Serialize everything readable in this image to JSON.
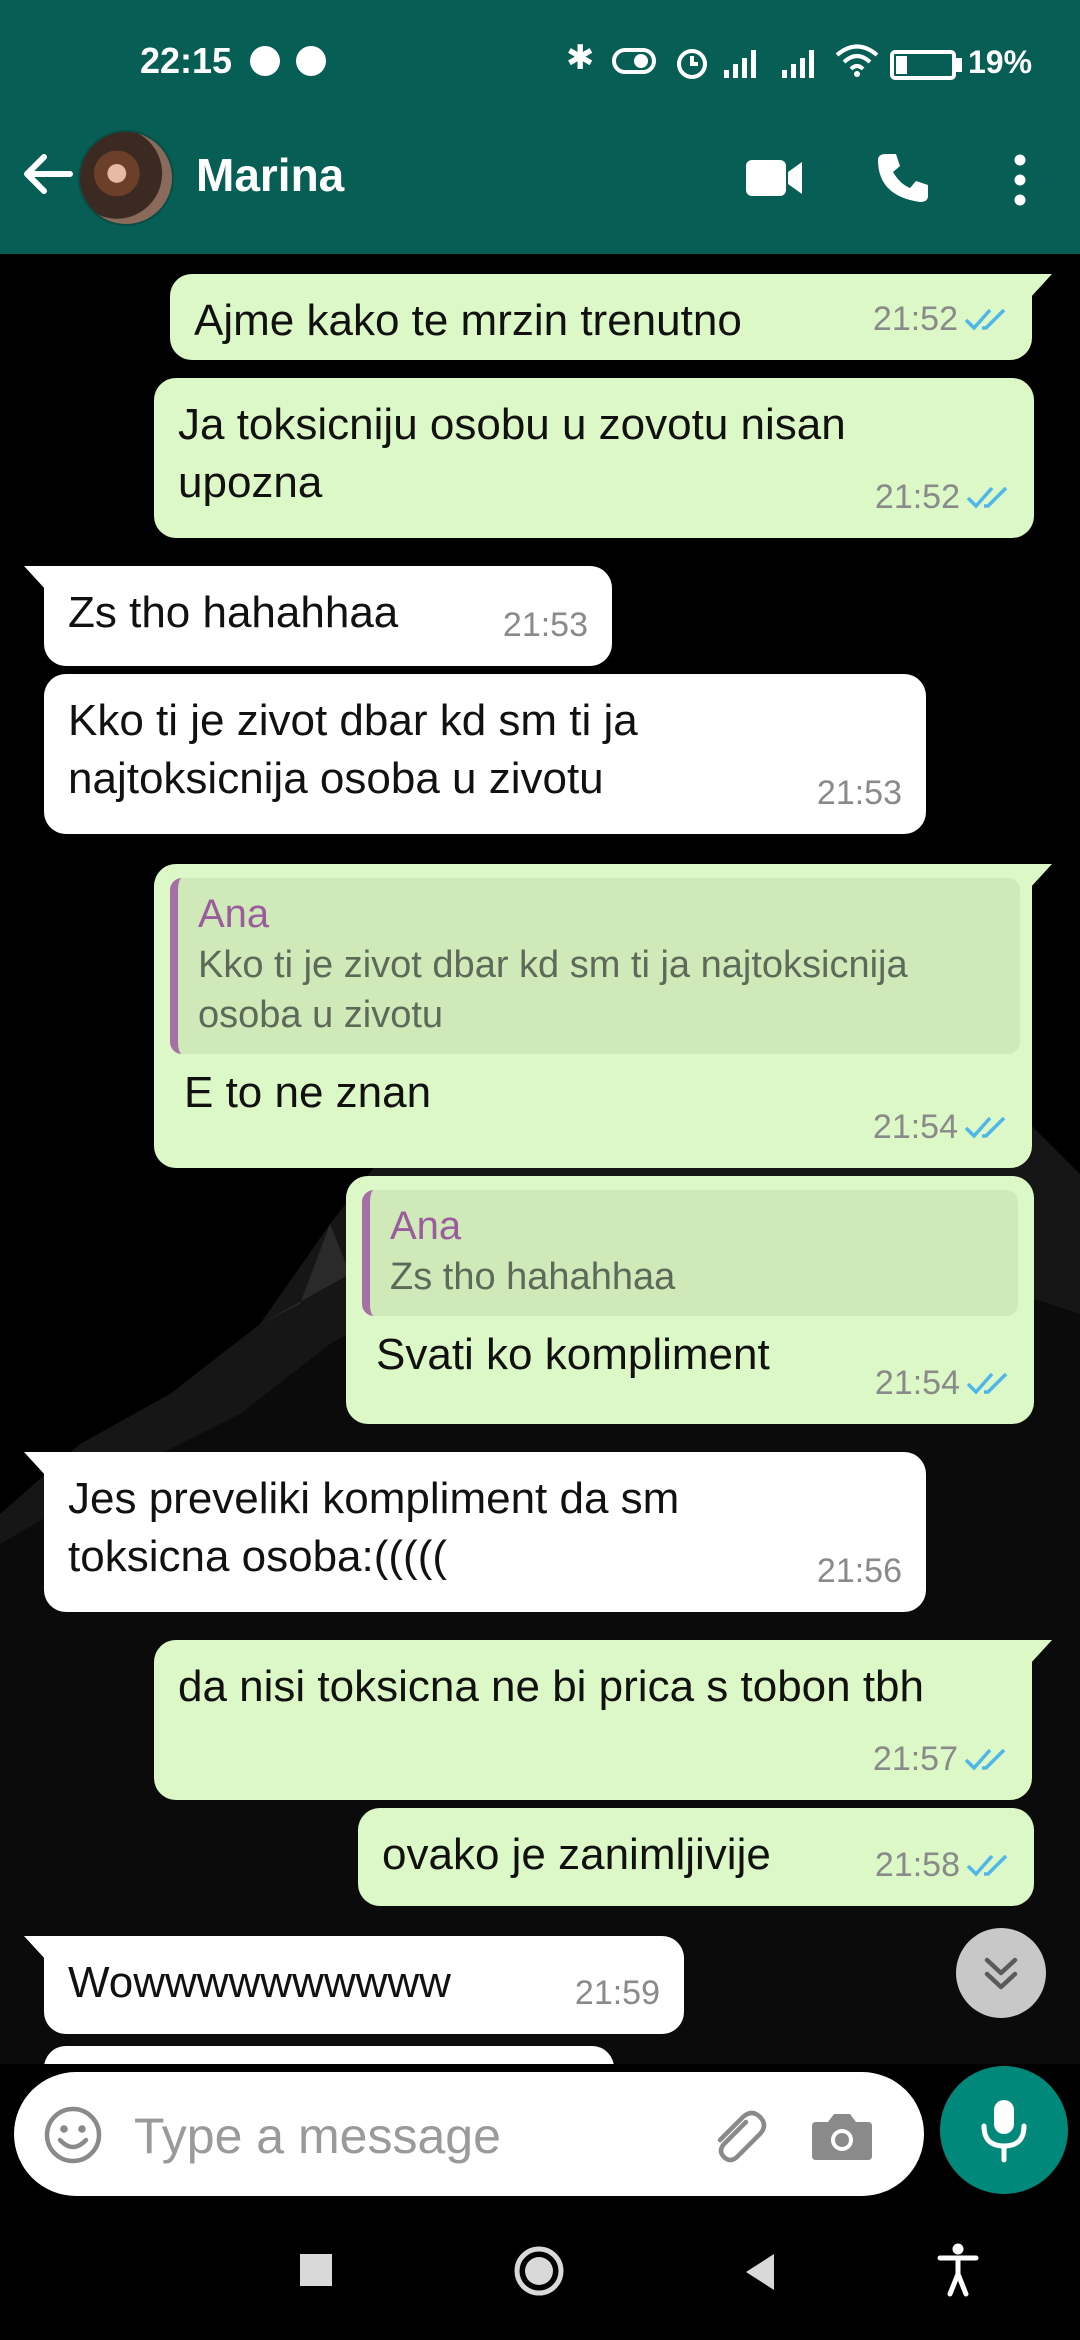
{
  "status_bar": {
    "time": "22:15",
    "battery_text": "19%",
    "battery_level": 0.19,
    "icons": [
      "spotify-icon",
      "messenger-icon",
      "bluetooth-icon",
      "toggle-icon",
      "alarm-icon",
      "signal-icon",
      "signal-icon",
      "wifi-icon",
      "battery-charging-icon"
    ]
  },
  "header": {
    "contact_name": "Marina",
    "icons": [
      "back-arrow-icon",
      "avatar",
      "video-call-icon",
      "phone-icon",
      "more-vert-icon"
    ]
  },
  "messages": [
    {
      "dir": "out",
      "text": "Ajme kako te mrzin trenutno",
      "time": "21:52",
      "ticks": "read"
    },
    {
      "dir": "out",
      "text": "Ja toksicniju osobu u zovotu nisan upozna",
      "time": "21:52",
      "ticks": "read"
    },
    {
      "dir": "in",
      "text": "Zs tho hahahhaa",
      "time": "21:53"
    },
    {
      "dir": "in",
      "text": "Kko ti je zivot dbar kd sm ti ja najtoksicnija osoba u zivotu",
      "time": "21:53"
    },
    {
      "dir": "out",
      "quote_author": "Ana",
      "quote_text": "Kko ti je zivot dbar kd sm ti ja najtoksicnija osoba u zivotu",
      "text": "E to ne znan",
      "time": "21:54",
      "ticks": "read"
    },
    {
      "dir": "out",
      "quote_author": "Ana",
      "quote_text": "Zs tho hahahhaa",
      "text": "Svati ko kompliment",
      "time": "21:54",
      "ticks": "read"
    },
    {
      "dir": "in",
      "text": "Jes preveliki kompliment da sm toksicna osoba:(((((",
      "time": "21:56"
    },
    {
      "dir": "out",
      "text": "da nisi toksicna ne bi prica s tobon tbh",
      "time": "21:57",
      "ticks": "read"
    },
    {
      "dir": "out",
      "text": "ovako je zanimljivije",
      "time": "21:58",
      "ticks": "read"
    },
    {
      "dir": "in",
      "text": "Wowwwwwwwwww",
      "time": "21:59"
    }
  ],
  "input": {
    "placeholder": "Type a message",
    "value": ""
  },
  "colors": {
    "header": "#075e54",
    "outgoing_bubble": "#dcf8c6",
    "incoming_bubble": "#ffffff",
    "read_ticks": "#4fb6ec",
    "mic_button": "#00897b",
    "quote_author": "#9b5c9e"
  },
  "nav_bar": {
    "icons": [
      "recents-square-icon",
      "home-circle-icon",
      "back-triangle-icon",
      "accessibility-icon"
    ]
  }
}
